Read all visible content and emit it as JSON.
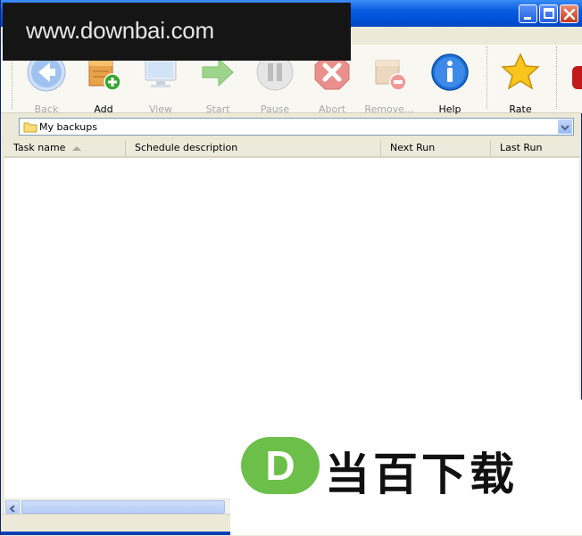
{
  "window": {
    "controls": [
      "minimize",
      "maximize",
      "close"
    ]
  },
  "toolbar": {
    "items": [
      {
        "label": "Back",
        "icon": "back-arrow-icon",
        "enabled": false
      },
      {
        "label": "Add",
        "icon": "add-icon",
        "enabled": true
      },
      {
        "label": "View",
        "icon": "monitor-icon",
        "enabled": false
      },
      {
        "label": "Start",
        "icon": "start-arrow-icon",
        "enabled": false
      },
      {
        "label": "Pause",
        "icon": "pause-icon",
        "enabled": false
      },
      {
        "label": "Abort",
        "icon": "abort-icon",
        "enabled": false
      },
      {
        "label": "Remove...",
        "icon": "remove-icon",
        "enabled": false
      },
      {
        "label": "Help",
        "icon": "info-icon",
        "enabled": true
      },
      {
        "label": "Rate",
        "icon": "star-icon",
        "enabled": true
      }
    ]
  },
  "path": {
    "value": "My backups"
  },
  "table": {
    "columns": [
      "Task name",
      "Schedule description",
      "Next Run",
      "Last Run"
    ],
    "sort_column": "Task name",
    "rows": []
  },
  "watermarks": {
    "site": "www.downbai.com",
    "brand_letter": "D",
    "brand_text": "当百下载"
  },
  "colors": {
    "titlebar": "#0054e3",
    "close_button": "#c4391b",
    "info_blue": "#1f6fd6",
    "star_yellow": "#f7c51c",
    "add_green": "#36a82f",
    "brand_green": "#6cc04a"
  }
}
